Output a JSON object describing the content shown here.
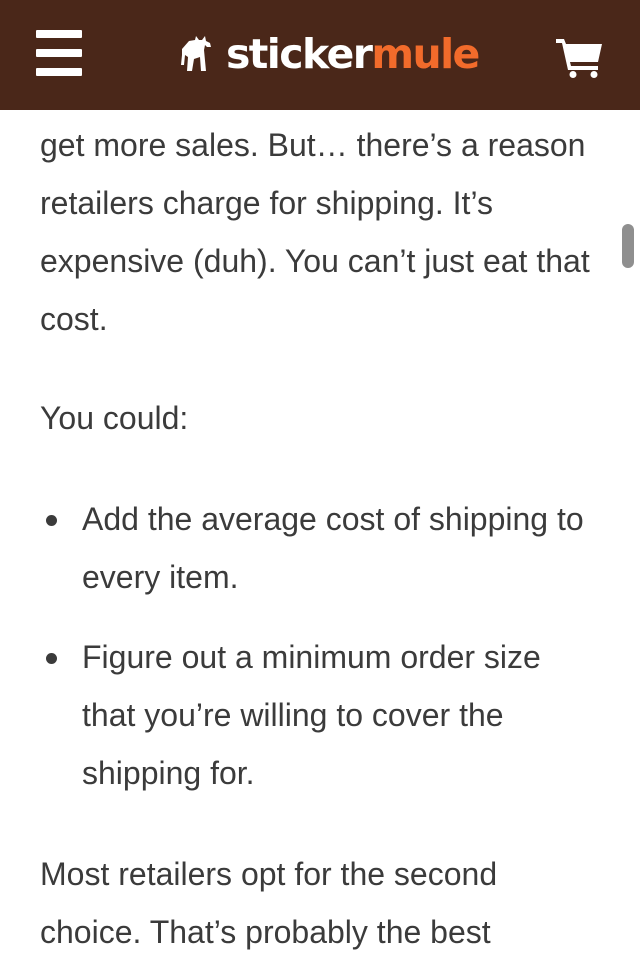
{
  "header": {
    "logo_sticker": "sticker",
    "logo_mule": "mule",
    "colors": {
      "background": "#4a2719",
      "logo_white": "#ffffff",
      "logo_orange": "#f26b2b"
    },
    "icons": {
      "menu": "hamburger-menu-icon",
      "logo": "mule-logo-icon",
      "cart": "shopping-cart-icon"
    }
  },
  "article": {
    "paragraph_1": "get more sales. But… there’s a reason retailers charge for shipping. It’s expensive (duh). You can’t just eat that cost.",
    "paragraph_2": "You could:",
    "bullets": [
      "Add the average cost of shipping to every item.",
      "Figure out a minimum order size that you’re willing to cover the shipping for."
    ],
    "paragraph_3": "Most retailers opt for the second choice. That’s probably the best"
  }
}
